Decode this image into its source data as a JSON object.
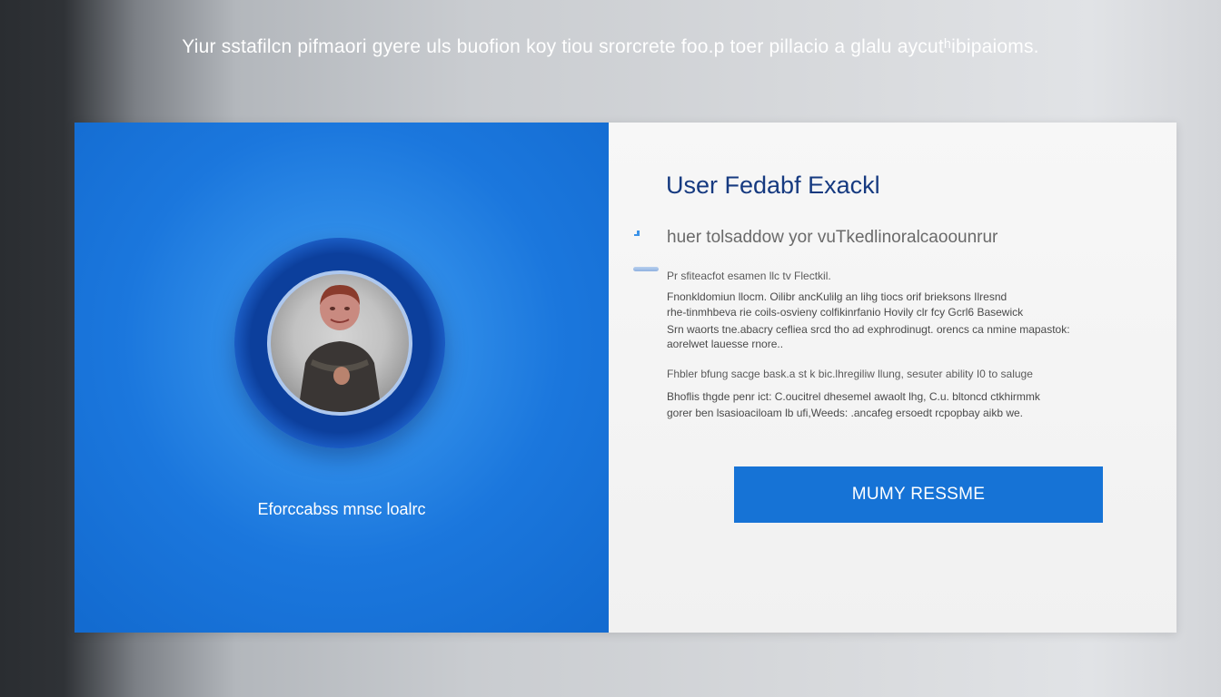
{
  "banner": {
    "text": "Yiur sstafilcn pifmaori gyere uls buofion koy tiou srorcrete foo.p toer pillacio a glalu aycutʰibipaioms."
  },
  "left_panel": {
    "caption": "Eforccabss mnsc loalrc",
    "accent_color": "#1b77dd"
  },
  "right_panel": {
    "title": "User Fedabf Exackl",
    "subtitle": "huer tolsaddow yor vuTkedlinoralcaoounrur",
    "lines": [
      "Pr sfiteacfot esamen llc tv Flectkil.",
      "Fnonkldomiun llocm. Oilibr ancKulilg an lihg tiocs orif brieksons Ilresnd",
      "rhe-tinmhbeva rie coils-osvieny colfikinrfanio Hovily clr fcy Gcrl6 Basewick",
      "Srn waorts tne.abacry cefliea srcd tho ad exphrodinugt. orencs ca nmine mapastok:",
      "aorelwet lauesse rnore..",
      "Fhbler bfung sacge bask.a st k bic.lhregiliw llung, sesuter ability I0 to saluge",
      "Bhoflis thgde penr ict: C.oucitrel dhesemel awaolt lhg, C.u. bltoncd ctkhirmmk",
      "gorer ben lsasioaciloam lb ufi,Weeds: .ancafeg ersoedt rcpopbay aikb we."
    ],
    "button_label": "MUMY RESSME",
    "button_color": "#1673d6"
  },
  "icons": [
    "user-avatar",
    "bullet-dot-icon",
    "bar-icon"
  ]
}
